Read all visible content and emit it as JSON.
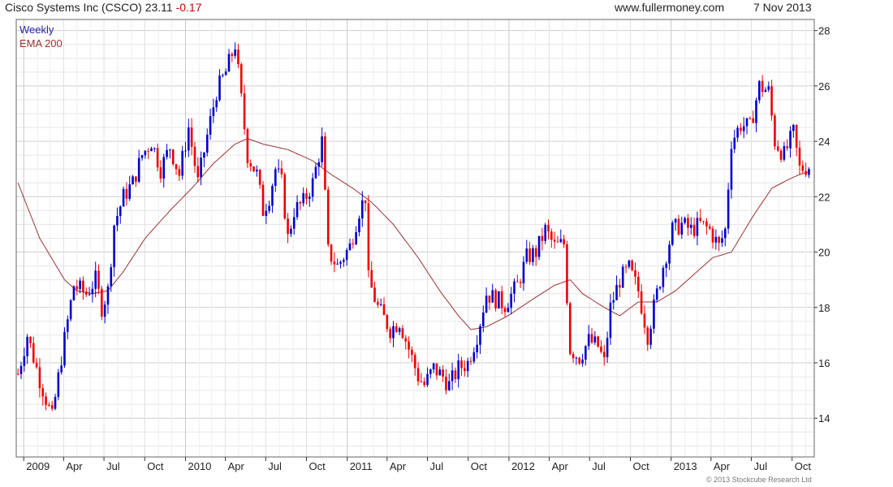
{
  "header": {
    "company": "Cisco Systems Inc (CSCO)",
    "price": "23.11",
    "change": "-0.17",
    "site": "www.fullermoney.com",
    "date": "7 Nov 2013"
  },
  "legend": {
    "weekly": "Weekly",
    "ema": "EMA 200"
  },
  "copyright": "© 2013 Stockcube Research Ltd",
  "colors": {
    "up": "#0000cc",
    "down": "#ee0000",
    "ema": "#993333",
    "grid": "#d8d8d8",
    "axis": "#333333"
  },
  "chart_data": {
    "type": "candlestick",
    "title": "",
    "ylim": [
      12.6,
      28.4
    ],
    "y_ticks": [
      14,
      16,
      18,
      20,
      22,
      24,
      26,
      28
    ],
    "x_ticks": [
      {
        "label": "2009",
        "date": "2009-01-01",
        "major": true
      },
      {
        "label": "Apr",
        "date": "2009-04-01",
        "major": false
      },
      {
        "label": "Jul",
        "date": "2009-07-01",
        "major": false
      },
      {
        "label": "Oct",
        "date": "2009-10-01",
        "major": false
      },
      {
        "label": "2010",
        "date": "2010-01-01",
        "major": true
      },
      {
        "label": "Apr",
        "date": "2010-04-01",
        "major": false
      },
      {
        "label": "Jul",
        "date": "2010-07-01",
        "major": false
      },
      {
        "label": "Oct",
        "date": "2010-10-01",
        "major": false
      },
      {
        "label": "2011",
        "date": "2011-01-01",
        "major": true
      },
      {
        "label": "Apr",
        "date": "2011-04-01",
        "major": false
      },
      {
        "label": "Jul",
        "date": "2011-07-01",
        "major": false
      },
      {
        "label": "Oct",
        "date": "2011-10-01",
        "major": false
      },
      {
        "label": "2012",
        "date": "2012-01-01",
        "major": true
      },
      {
        "label": "Apr",
        "date": "2012-04-01",
        "major": false
      },
      {
        "label": "Jul",
        "date": "2012-07-01",
        "major": false
      },
      {
        "label": "Oct",
        "date": "2012-10-01",
        "major": false
      },
      {
        "label": "2013",
        "date": "2013-01-01",
        "major": true
      },
      {
        "label": "Apr",
        "date": "2013-04-01",
        "major": false
      },
      {
        "label": "Jul",
        "date": "2013-07-01",
        "major": false
      },
      {
        "label": "Oct",
        "date": "2013-10-01",
        "major": false
      }
    ],
    "xlim": [
      "2008-12-15",
      "2013-11-20"
    ],
    "price_path": [
      [
        "2008-12-19",
        15.6
      ],
      [
        "2009-01-09",
        17.0
      ],
      [
        "2009-02-06",
        15.4
      ],
      [
        "2009-03-06",
        14.0
      ],
      [
        "2009-03-27",
        16.2
      ],
      [
        "2009-04-24",
        18.8
      ],
      [
        "2009-05-22",
        18.5
      ],
      [
        "2009-06-12",
        19.0
      ],
      [
        "2009-06-26",
        18.0
      ],
      [
        "2009-07-10",
        18.6
      ],
      [
        "2009-07-24",
        21.0
      ],
      [
        "2009-08-14",
        22.0
      ],
      [
        "2009-09-04",
        22.5
      ],
      [
        "2009-09-25",
        23.5
      ],
      [
        "2009-10-16",
        24.0
      ],
      [
        "2009-11-06",
        23.0
      ],
      [
        "2009-11-27",
        23.8
      ],
      [
        "2009-12-18",
        22.8
      ],
      [
        "2010-01-08",
        24.5
      ],
      [
        "2010-01-29",
        22.5
      ],
      [
        "2010-02-19",
        24.2
      ],
      [
        "2010-03-12",
        25.8
      ],
      [
        "2010-04-02",
        26.5
      ],
      [
        "2010-04-23",
        27.5
      ],
      [
        "2010-05-07",
        25.5
      ],
      [
        "2010-05-21",
        23.5
      ],
      [
        "2010-06-11",
        22.8
      ],
      [
        "2010-06-25",
        21.5
      ],
      [
        "2010-07-09",
        22.0
      ],
      [
        "2010-07-23",
        23.0
      ],
      [
        "2010-08-06",
        22.5
      ],
      [
        "2010-08-20",
        20.5
      ],
      [
        "2010-09-03",
        21.5
      ],
      [
        "2010-09-24",
        21.8
      ],
      [
        "2010-10-15",
        22.5
      ],
      [
        "2010-11-05",
        24.0
      ],
      [
        "2010-11-19",
        20.0
      ],
      [
        "2010-12-10",
        19.5
      ],
      [
        "2011-01-07",
        20.2
      ],
      [
        "2011-01-28",
        21.5
      ],
      [
        "2011-02-11",
        22.0
      ],
      [
        "2011-02-18",
        19.0
      ],
      [
        "2011-03-11",
        18.0
      ],
      [
        "2011-04-08",
        17.2
      ],
      [
        "2011-04-29",
        17.5
      ],
      [
        "2011-05-20",
        16.5
      ],
      [
        "2011-06-10",
        15.5
      ],
      [
        "2011-06-24",
        15.2
      ],
      [
        "2011-07-15",
        15.8
      ],
      [
        "2011-08-05",
        15.5
      ],
      [
        "2011-08-19",
        15.2
      ],
      [
        "2011-09-09",
        15.8
      ],
      [
        "2011-09-30",
        16.0
      ],
      [
        "2011-10-21",
        17.0
      ],
      [
        "2011-11-11",
        18.5
      ],
      [
        "2011-12-02",
        18.3
      ],
      [
        "2011-12-23",
        18.1
      ],
      [
        "2012-01-20",
        18.8
      ],
      [
        "2012-02-10",
        19.8
      ],
      [
        "2012-03-02",
        20.0
      ],
      [
        "2012-03-23",
        20.8
      ],
      [
        "2012-04-13",
        20.2
      ],
      [
        "2012-05-04",
        20.3
      ],
      [
        "2012-05-18",
        16.5
      ],
      [
        "2012-06-08",
        16.2
      ],
      [
        "2012-06-29",
        16.8
      ],
      [
        "2012-07-20",
        16.6
      ],
      [
        "2012-08-03",
        16.0
      ],
      [
        "2012-08-17",
        18.0
      ],
      [
        "2012-09-07",
        19.0
      ],
      [
        "2012-09-28",
        19.4
      ],
      [
        "2012-10-19",
        18.6
      ],
      [
        "2012-11-09",
        17.0
      ],
      [
        "2012-11-23",
        18.0
      ],
      [
        "2012-12-14",
        19.5
      ],
      [
        "2013-01-04",
        20.8
      ],
      [
        "2013-01-25",
        21.0
      ],
      [
        "2013-02-15",
        20.8
      ],
      [
        "2013-03-08",
        21.0
      ],
      [
        "2013-03-29",
        20.8
      ],
      [
        "2013-04-19",
        20.2
      ],
      [
        "2013-05-03",
        20.8
      ],
      [
        "2013-05-17",
        24.0
      ],
      [
        "2013-06-07",
        24.6
      ],
      [
        "2013-06-28",
        24.5
      ],
      [
        "2013-07-19",
        26.0
      ],
      [
        "2013-08-09",
        25.8
      ],
      [
        "2013-08-23",
        24.0
      ],
      [
        "2013-09-13",
        23.5
      ],
      [
        "2013-10-04",
        24.3
      ],
      [
        "2013-10-18",
        23.0
      ],
      [
        "2013-11-08",
        23.1
      ]
    ],
    "ema_path": [
      [
        "2008-12-19",
        22.5
      ],
      [
        "2009-02-06",
        20.5
      ],
      [
        "2009-04-03",
        19.0
      ],
      [
        "2009-05-01",
        18.6
      ],
      [
        "2009-06-05",
        18.5
      ],
      [
        "2009-07-10",
        18.6
      ],
      [
        "2009-08-14",
        19.3
      ],
      [
        "2009-10-02",
        20.5
      ],
      [
        "2009-11-27",
        21.5
      ],
      [
        "2010-01-15",
        22.3
      ],
      [
        "2010-03-05",
        23.2
      ],
      [
        "2010-04-23",
        23.9
      ],
      [
        "2010-05-21",
        24.1
      ],
      [
        "2010-06-25",
        23.9
      ],
      [
        "2010-08-20",
        23.7
      ],
      [
        "2010-10-15",
        23.3
      ],
      [
        "2010-11-26",
        22.8
      ],
      [
        "2011-01-14",
        22.3
      ],
      [
        "2011-02-25",
        21.8
      ],
      [
        "2011-04-15",
        21.0
      ],
      [
        "2011-06-10",
        19.8
      ],
      [
        "2011-07-29",
        18.6
      ],
      [
        "2011-09-09",
        17.7
      ],
      [
        "2011-10-07",
        17.2
      ],
      [
        "2011-11-11",
        17.3
      ],
      [
        "2011-12-30",
        17.7
      ],
      [
        "2012-02-24",
        18.3
      ],
      [
        "2012-04-13",
        18.8
      ],
      [
        "2012-05-18",
        19.0
      ],
      [
        "2012-06-15",
        18.5
      ],
      [
        "2012-08-03",
        18.0
      ],
      [
        "2012-09-07",
        17.7
      ],
      [
        "2012-10-19",
        18.2
      ],
      [
        "2012-11-30",
        18.2
      ],
      [
        "2013-01-11",
        18.6
      ],
      [
        "2013-02-22",
        19.2
      ],
      [
        "2013-04-05",
        19.8
      ],
      [
        "2013-05-17",
        20.0
      ],
      [
        "2013-07-05",
        21.3
      ],
      [
        "2013-08-16",
        22.3
      ],
      [
        "2013-09-20",
        22.6
      ],
      [
        "2013-10-18",
        22.8
      ],
      [
        "2013-11-08",
        22.9
      ]
    ]
  }
}
